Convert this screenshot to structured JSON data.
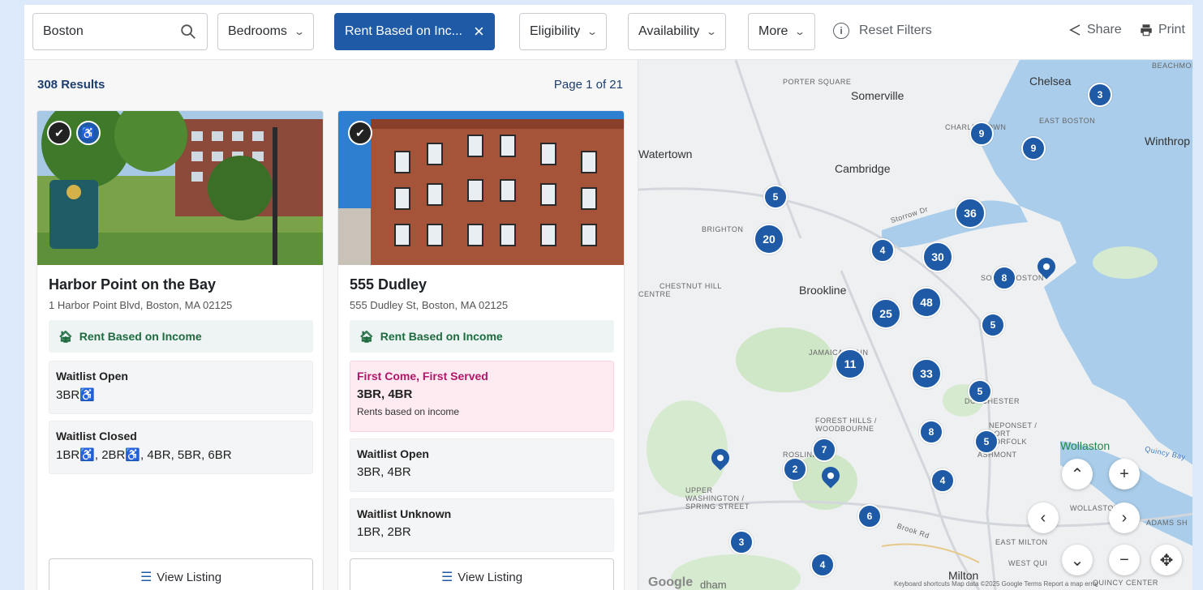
{
  "toolbar": {
    "search_value": "Boston",
    "bedrooms_label": "Bedrooms",
    "rent_filter_label": "Rent Based on Inc...",
    "eligibility_label": "Eligibility",
    "availability_label": "Availability",
    "more_label": "More",
    "reset_label": "Reset Filters",
    "share_label": "Share",
    "print_label": "Print",
    "accent_color": "#1e5aa6"
  },
  "results": {
    "count_label": "308 Results",
    "page_label": "Page 1 of 21"
  },
  "listings": [
    {
      "name": "Harbor Point on the Bay",
      "address": "1 Harbor Point Blvd, Boston, MA 02125",
      "rent_type": "Rent Based on Income",
      "sections": [
        {
          "title": "Waitlist Open",
          "value": "3BR♿"
        },
        {
          "title": "Waitlist Closed",
          "value": "1BR♿, 2BR♿, 4BR, 5BR, 6BR"
        }
      ],
      "view_label": "View Listing"
    },
    {
      "name": "555 Dudley",
      "address": "555 Dudley St, Boston, MA 02125",
      "rent_type": "Rent Based on Income",
      "highlight": {
        "title": "First Come, First Served",
        "value": "3BR, 4BR",
        "sub": "Rents based on income"
      },
      "sections": [
        {
          "title": "Waitlist Open",
          "value": "3BR, 4BR"
        },
        {
          "title": "Waitlist Unknown",
          "value": "1BR, 2BR"
        }
      ],
      "view_label": "View Listing"
    }
  ],
  "map": {
    "labels": {
      "somerville": "Somerville",
      "porter": "PORTER SQUARE",
      "chelsea": "Chelsea",
      "charlestown": "CHARLESTOWN",
      "eastboston": "EAST BOSTON",
      "winthrop": "Winthrop",
      "watertown": "Watertown",
      "cambridge": "Cambridge",
      "brighton": "BRIGHTON",
      "storrow": "Storrow Dr",
      "chestnut": "CHESTNUT HILL",
      "centre": "CENTRE",
      "brookline": "Brookline",
      "southboston": "SOUTH BOSTON",
      "jamaica": "JAMAICA PLAIN",
      "dorchester": "DORCHESTER",
      "foresthills": "FOREST HILLS / WOODBOURNE",
      "neponset": "NEPONSET / PORT NORFOLK",
      "roslindale": "ROSLINDALE",
      "ashmont": "ASHMONT",
      "wollaston": "Wollaston",
      "quincybay": "Quincy Bay",
      "upper": "UPPER WASHINGTON / SPRING STREET",
      "wollastonsm": "WOLLASTON",
      "adams": "ADAMS SH",
      "brookrd": "Brook Rd",
      "eastmilton": "EAST MILTON",
      "westquincy": "WEST QUI",
      "milton": "Milton",
      "quincycenter": "QUINCY CENTER",
      "beachmont": "BEACHMONT",
      "dedham": "dham",
      "attribution": "Keyboard shortcuts   Map data ©2025 Google   Terms   Report a map error"
    },
    "clusters": [
      "3",
      "9",
      "9",
      "36",
      "5",
      "20",
      "4",
      "30",
      "8",
      "25",
      "48",
      "5",
      "11",
      "33",
      "5",
      "8",
      "5",
      "7",
      "2",
      "4",
      "6",
      "3",
      "4"
    ],
    "google_logo": "Google"
  }
}
